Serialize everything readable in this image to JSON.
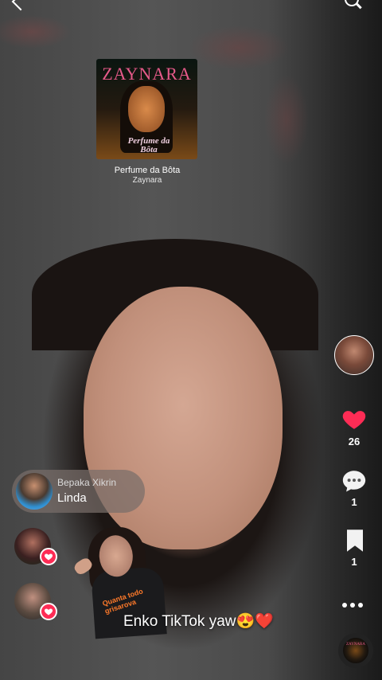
{
  "nav": {
    "back_icon": "chevron-left-icon",
    "search_icon": "search-icon"
  },
  "music": {
    "album_artist_art": "ZAYNARA",
    "album_track_art": "Perfume da Bôta",
    "title": "Perfume da Bôta",
    "artist": "Zaynara"
  },
  "actions": {
    "likes": "26",
    "comments": "1",
    "saves": "1",
    "like_color": "#fe2c55",
    "disc_label": "ZAYNARA"
  },
  "comment": {
    "user": "Bepaka Xikrin",
    "text": "Linda"
  },
  "sticker": {
    "text": "Quanta todo grisarova"
  },
  "caption": "Enko TikTok yaw😍❤️"
}
